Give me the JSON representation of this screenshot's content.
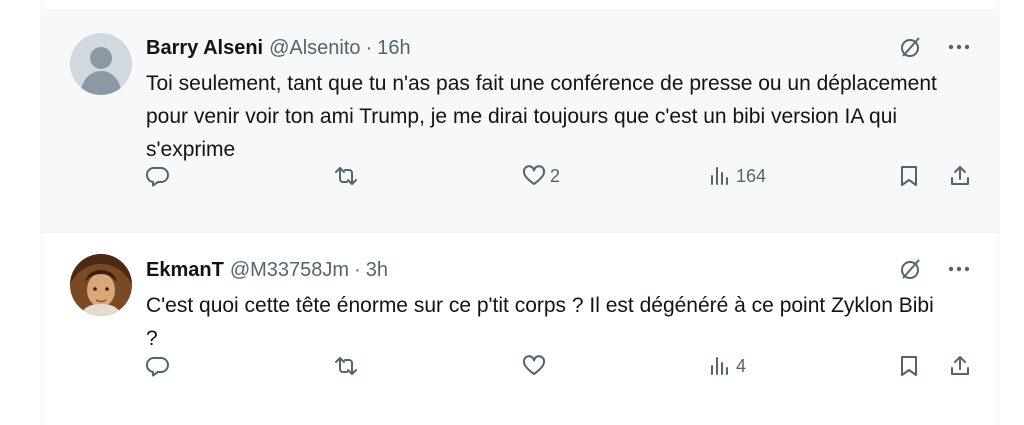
{
  "colors": {
    "text": "#0f1419",
    "secondary": "#536471",
    "hover_bg": "#f7f9f9",
    "border": "#eff3f4"
  },
  "tweets": [
    {
      "name": "Barry Alseni",
      "handle": "@Alsenito",
      "separator": "·",
      "time": "16h",
      "text": "Toi seulement, tant que tu n'as pas fait une conférence de presse ou un déplacement pour venir voir ton ami Trump, je me dirai toujours que c'est un bibi version IA qui s'exprime",
      "avatar": "default-avatar",
      "likes": "2",
      "views": "164"
    },
    {
      "name": "EkmanT",
      "handle": "@M33758Jm",
      "separator": "·",
      "time": "3h",
      "text": "C'est quoi cette tête énorme sur ce p'tit corps ? Il est dégénéré à ce point Zyklon Bibi ?",
      "avatar": "photo-avatar",
      "likes": "",
      "views": "4"
    }
  ],
  "icons": [
    "grok-icon",
    "more-icon",
    "reply-icon",
    "retweet-icon",
    "like-icon",
    "views-icon",
    "bookmark-icon",
    "share-icon"
  ]
}
